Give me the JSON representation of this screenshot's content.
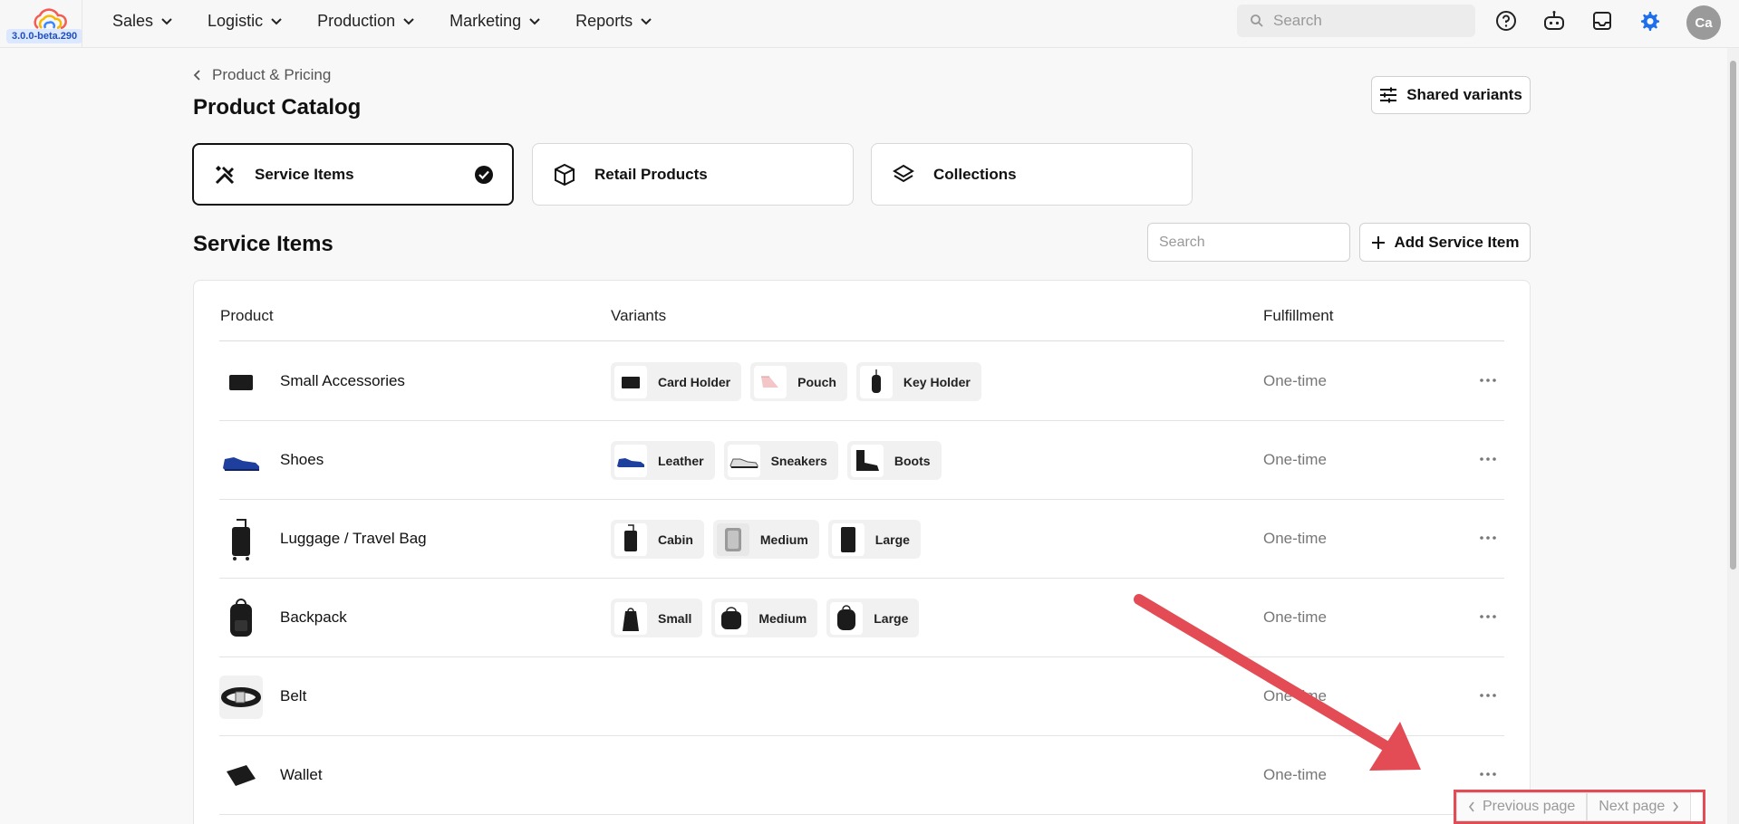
{
  "app": {
    "version": "3.0.0-beta.290"
  },
  "nav": {
    "items": [
      {
        "label": "Sales"
      },
      {
        "label": "Logistic"
      },
      {
        "label": "Production"
      },
      {
        "label": "Marketing"
      },
      {
        "label": "Reports"
      }
    ],
    "search_placeholder": "Search",
    "icons": [
      "help-icon",
      "robot-icon",
      "inbox-icon",
      "gear-icon"
    ],
    "avatar_initials": "Ca"
  },
  "header": {
    "breadcrumb": "Product & Pricing",
    "title": "Product Catalog",
    "shared_variants_label": "Shared variants"
  },
  "categories": [
    {
      "label": "Service Items",
      "icon": "tools-icon",
      "selected": true
    },
    {
      "label": "Retail Products",
      "icon": "box-icon",
      "selected": false
    },
    {
      "label": "Collections",
      "icon": "layers-icon",
      "selected": false
    }
  ],
  "list": {
    "title": "Service Items",
    "search_placeholder": "Search",
    "add_label": "Add Service Item",
    "columns": {
      "product": "Product",
      "variants": "Variants",
      "fulfillment": "Fulfillment"
    },
    "rows": [
      {
        "name": "Small Accessories",
        "icon": "card-holder-icon",
        "variants": [
          "Card Holder",
          "Pouch",
          "Key Holder"
        ],
        "variant_icons": [
          "card-holder-icon",
          "pouch-icon",
          "key-holder-icon"
        ],
        "fulfillment": "One-time"
      },
      {
        "name": "Shoes",
        "icon": "shoe-icon",
        "variants": [
          "Leather",
          "Sneakers",
          "Boots"
        ],
        "variant_icons": [
          "shoe-icon",
          "sneaker-icon",
          "boot-icon"
        ],
        "fulfillment": "One-time"
      },
      {
        "name": "Luggage / Travel Bag",
        "icon": "luggage-icon",
        "variants": [
          "Cabin",
          "Medium",
          "Large"
        ],
        "variant_icons": [
          "luggage-icon",
          "luggage-icon",
          "luggage-icon"
        ],
        "fulfillment": "One-time"
      },
      {
        "name": "Backpack",
        "icon": "backpack-icon",
        "variants": [
          "Small",
          "Medium",
          "Large"
        ],
        "variant_icons": [
          "backpack-icon",
          "backpack-icon",
          "backpack-icon"
        ],
        "fulfillment": "One-time"
      },
      {
        "name": "Belt",
        "icon": "belt-icon",
        "variants": [],
        "variant_icons": [],
        "fulfillment": "One-time"
      },
      {
        "name": "Wallet",
        "icon": "wallet-icon",
        "variants": [],
        "variant_icons": [],
        "fulfillment": "One-time"
      }
    ]
  },
  "pagination": {
    "previous_label": "Previous page",
    "next_label": "Next page"
  },
  "colors": {
    "annotation": "#e34b55",
    "accent": "#1f6feb"
  }
}
